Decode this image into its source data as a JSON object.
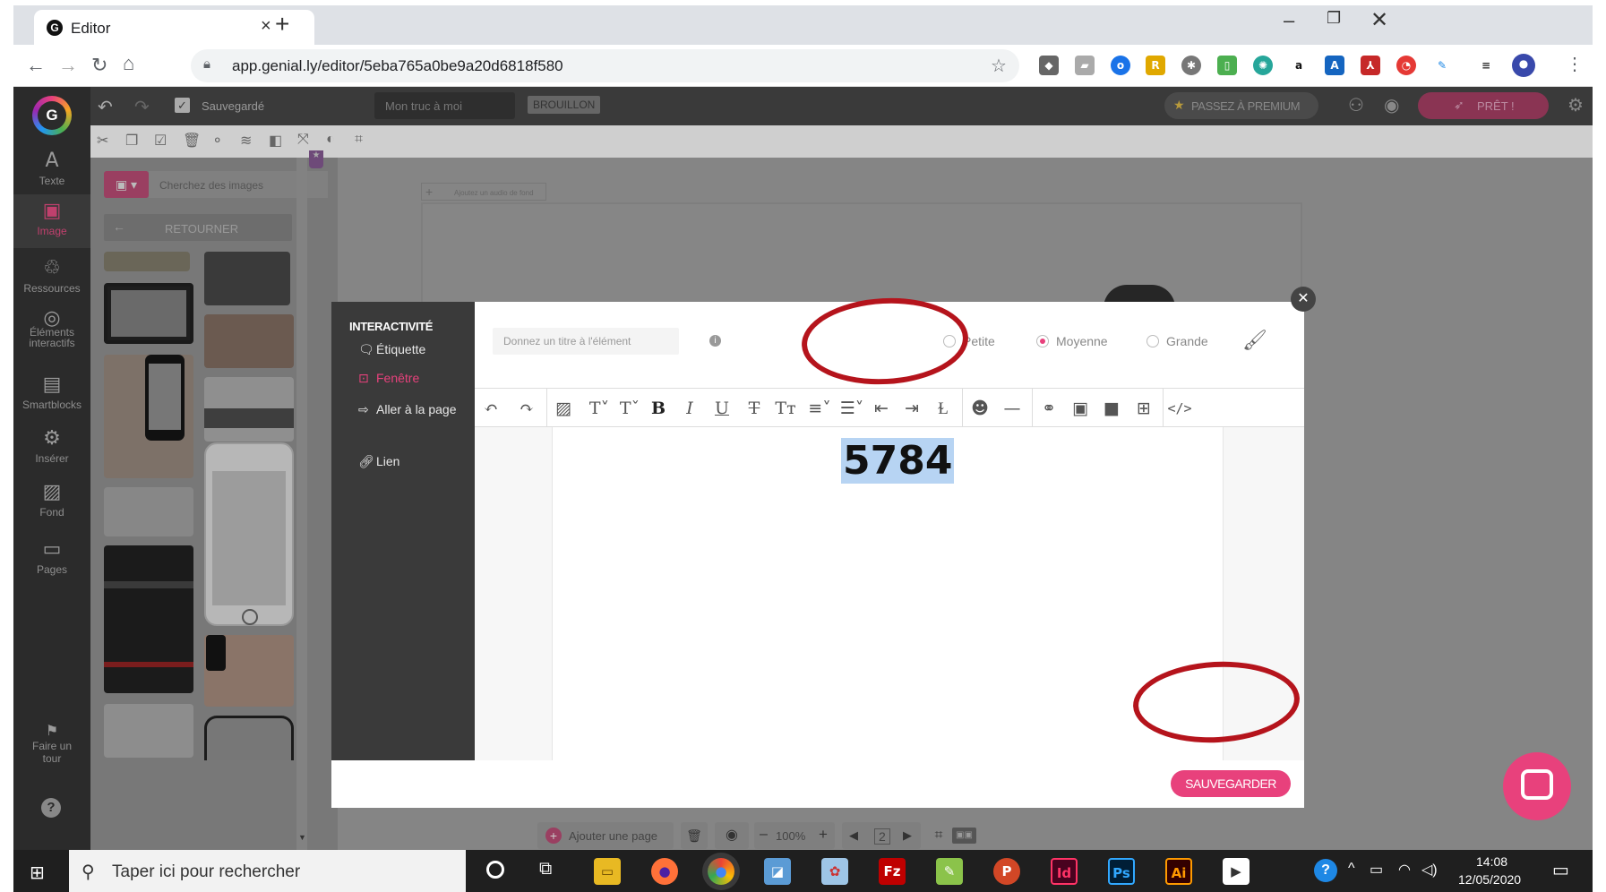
{
  "browser": {
    "tab_title": "Editor",
    "url": "app.genial.ly/editor/5eba765a0be9a20d6818f580",
    "window_controls": [
      "minimize-icon",
      "restore-icon",
      "close-icon"
    ]
  },
  "app": {
    "save_status": "Sauvegardé",
    "project_name": "Mon truc à moi",
    "draft_badge": "BROUILLON",
    "premium_label": "PASSEZ À PREMIUM",
    "ready_label": "PRÊT !",
    "audio_hint": "Ajoutez un audio de fond"
  },
  "nav": {
    "items": [
      {
        "label": "Texte",
        "icon": "A"
      },
      {
        "label": "Image",
        "icon": "▣"
      },
      {
        "label": "Ressources",
        "icon": "♲"
      },
      {
        "label": "Éléments interactifs",
        "icon": "◎"
      },
      {
        "label": "Smartblocks",
        "icon": "▤"
      },
      {
        "label": "Insérer",
        "icon": "⚙"
      },
      {
        "label": "Fond",
        "icon": "▨"
      },
      {
        "label": "Pages",
        "icon": "▭"
      }
    ],
    "tour_label": "Faire un tour",
    "help": "?"
  },
  "image_panel": {
    "search_placeholder": "Cherchez des images",
    "back_label": "RETOURNER"
  },
  "modal": {
    "section_title": "INTERACTIVITÉ",
    "side_items": [
      {
        "label": "Étiquette",
        "active": false
      },
      {
        "label": "Fenêtre",
        "active": true
      },
      {
        "label": "Aller à la page",
        "active": false
      },
      {
        "label": "Lien",
        "active": false
      }
    ],
    "title_placeholder": "Donnez un titre à l'élément",
    "sizes": [
      {
        "label": "Petite",
        "selected": false
      },
      {
        "label": "Moyenne",
        "selected": true
      },
      {
        "label": "Grande",
        "selected": false
      }
    ],
    "content_text": "5784",
    "save_button": "SAUVEGARDER"
  },
  "bottom_bar": {
    "add_page": "Ajouter une page",
    "zoom": "100%",
    "page_number": "2"
  },
  "taskbar": {
    "search_placeholder": "Taper ici pour rechercher",
    "time": "14:08",
    "date": "12/05/2020"
  },
  "colors": {
    "accent_pink": "#e8417c",
    "annotation_red": "#b5141c",
    "dark_panel": "#3a3a3a"
  }
}
